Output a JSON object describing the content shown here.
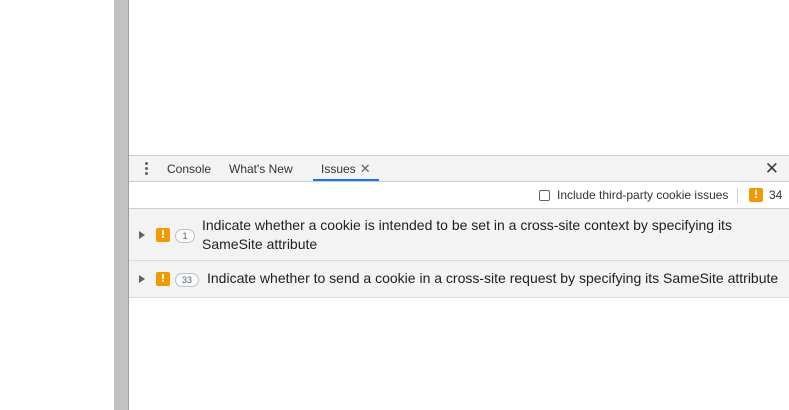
{
  "devtools": {
    "tabs": [
      {
        "label": "Console"
      },
      {
        "label": "What's New"
      },
      {
        "label": "Issues",
        "active": true,
        "closable": true
      }
    ],
    "tab_close_glyph": "✕",
    "drawer_close_glyph": "✕",
    "menu_icon": "kebab-menu-icon"
  },
  "toolbar": {
    "include_third_party_label": "Include third-party cookie issues",
    "include_third_party_checked": false,
    "warning_icon_glyph": "!",
    "issue_count": "34"
  },
  "issues": [
    {
      "count": "1",
      "title": "Indicate whether a cookie is intended to be set in a cross-site context by specifying its SameSite attribute",
      "severity": "warning"
    },
    {
      "count": "33",
      "title": "Indicate whether to send a cookie in a cross-site request by specifying its SameSite attribute",
      "severity": "warning"
    }
  ],
  "colors": {
    "warning": "#f29900",
    "active_tab_underline": "#1a73e8",
    "gutter": "#c2c2c2"
  }
}
